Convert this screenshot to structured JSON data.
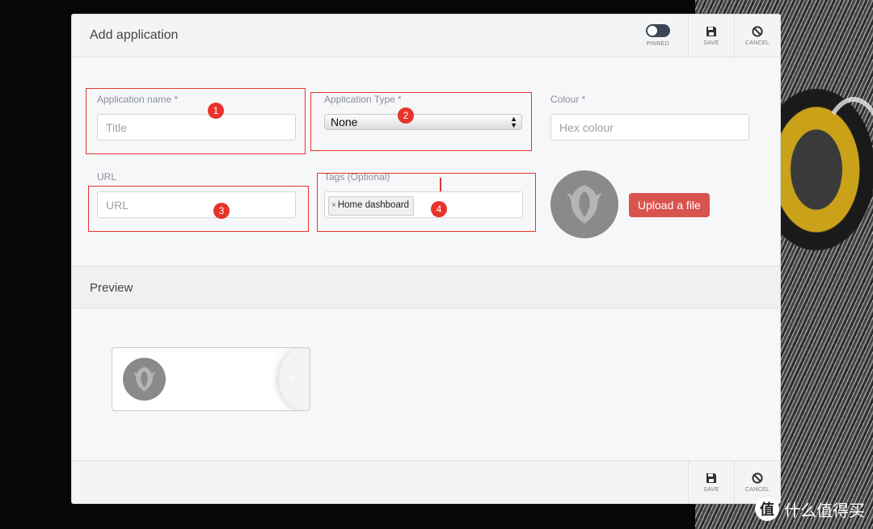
{
  "dialog": {
    "title": "Add application",
    "pinned_label": "PINNED",
    "save_label": "SAVE",
    "cancel_label": "CANCEL"
  },
  "form": {
    "app_name": {
      "label": "Application name *",
      "placeholder": "Title"
    },
    "app_type": {
      "label": "Application Type *",
      "value": "None"
    },
    "colour": {
      "label": "Colour *",
      "placeholder": "Hex colour"
    },
    "url": {
      "label": "URL",
      "placeholder": "URL"
    },
    "tags": {
      "label": "Tags (Optional)",
      "chips": [
        "Home dashboard"
      ],
      "remove_glyph": "×"
    },
    "upload_label": "Upload a file"
  },
  "annotations": [
    "1",
    "2",
    "3",
    "4"
  ],
  "preview": {
    "title": "Preview"
  },
  "footer": {
    "save_label": "SAVE",
    "cancel_label": "CANCEL"
  },
  "watermark": {
    "icon": "值",
    "text": "什么值得买"
  },
  "colors": {
    "accent_red": "#e8332c",
    "upload_button": "#d9534f",
    "toggle": "#3b4656"
  }
}
